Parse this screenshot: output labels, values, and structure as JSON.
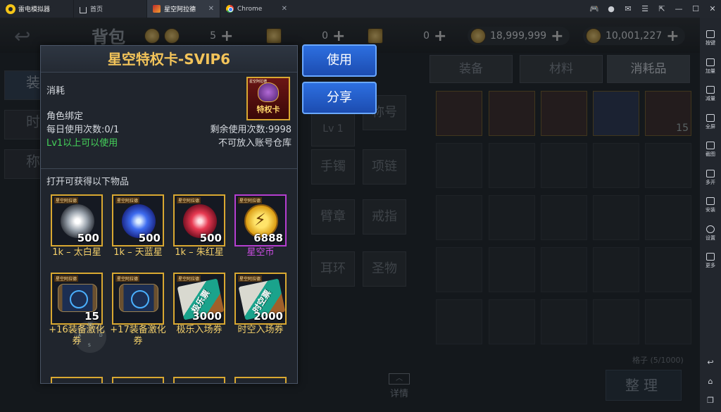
{
  "emulator": {
    "app_name": "雷电模拟器",
    "tabs": [
      {
        "label": "首页"
      },
      {
        "label": "星空阿拉德"
      },
      {
        "label": "Chrome"
      }
    ],
    "sidebar": [
      {
        "label": "按键"
      },
      {
        "label": "加量"
      },
      {
        "label": "减量"
      },
      {
        "label": "全屏"
      },
      {
        "label": "截图"
      },
      {
        "label": "多开"
      },
      {
        "label": "安装"
      },
      {
        "label": "设置"
      },
      {
        "label": "更多"
      }
    ]
  },
  "game": {
    "bag_title": "背包",
    "resources": [
      {
        "value": "5"
      },
      {
        "value": "0"
      },
      {
        "value": "0"
      },
      {
        "value": "18,999,999"
      },
      {
        "value": "10,001,227"
      }
    ],
    "left_tabs": [
      "装",
      "时",
      "称"
    ],
    "equip_slots": [
      "Lv 1",
      "称号",
      "手镯",
      "项链",
      "臂章",
      "戒指",
      "耳环",
      "圣物"
    ],
    "category_tabs": [
      {
        "label": "装备"
      },
      {
        "label": "材料"
      },
      {
        "label": "消耗品"
      }
    ],
    "inventory_first_count": "15",
    "grid_count": "格子 (5/1000)",
    "sort_button": "整理",
    "detail_button": "详情",
    "detail_chevron": "︿"
  },
  "popup": {
    "title": "星空特权卡-SVIP6",
    "type": "消耗",
    "bind": "角色绑定",
    "daily_uses": "每日使用次数:0/1",
    "remaining_uses": "剩余使用次数:9998",
    "level_req": "Lv1以上可以使用",
    "no_account_storage": "不可放入账号仓库",
    "item_icon_label": "特权卡",
    "item_icon_tag": "星空阿拉德",
    "rewards_header": "打开可获得以下物品",
    "rewards": [
      {
        "qty": "500",
        "label": "1k – 太白星",
        "tag": "星空阿拉德"
      },
      {
        "qty": "500",
        "label": "1k – 天蓝星",
        "tag": "星空阿拉德"
      },
      {
        "qty": "500",
        "label": "1k – 朱红星",
        "tag": "星空阿拉德"
      },
      {
        "qty": "6888",
        "label": "星空币",
        "tag": "星空阿拉德"
      },
      {
        "qty": "15",
        "label": "+16装备激化券",
        "tag": "星空阿拉德"
      },
      {
        "qty": "",
        "label": "+17装备激化券",
        "tag": "星空阿拉德"
      },
      {
        "qty": "3000",
        "label": "极乐入场券",
        "tag": "星空阿拉德",
        "ticket_text": "极乐票"
      },
      {
        "qty": "2000",
        "label": "时空入场券",
        "tag": "星空阿拉德",
        "ticket_text": "时空票"
      }
    ]
  },
  "actions": {
    "use": "使用",
    "share": "分享"
  },
  "joystick": {
    "w": "W",
    "a": "A",
    "d": "D",
    "s": "S"
  }
}
